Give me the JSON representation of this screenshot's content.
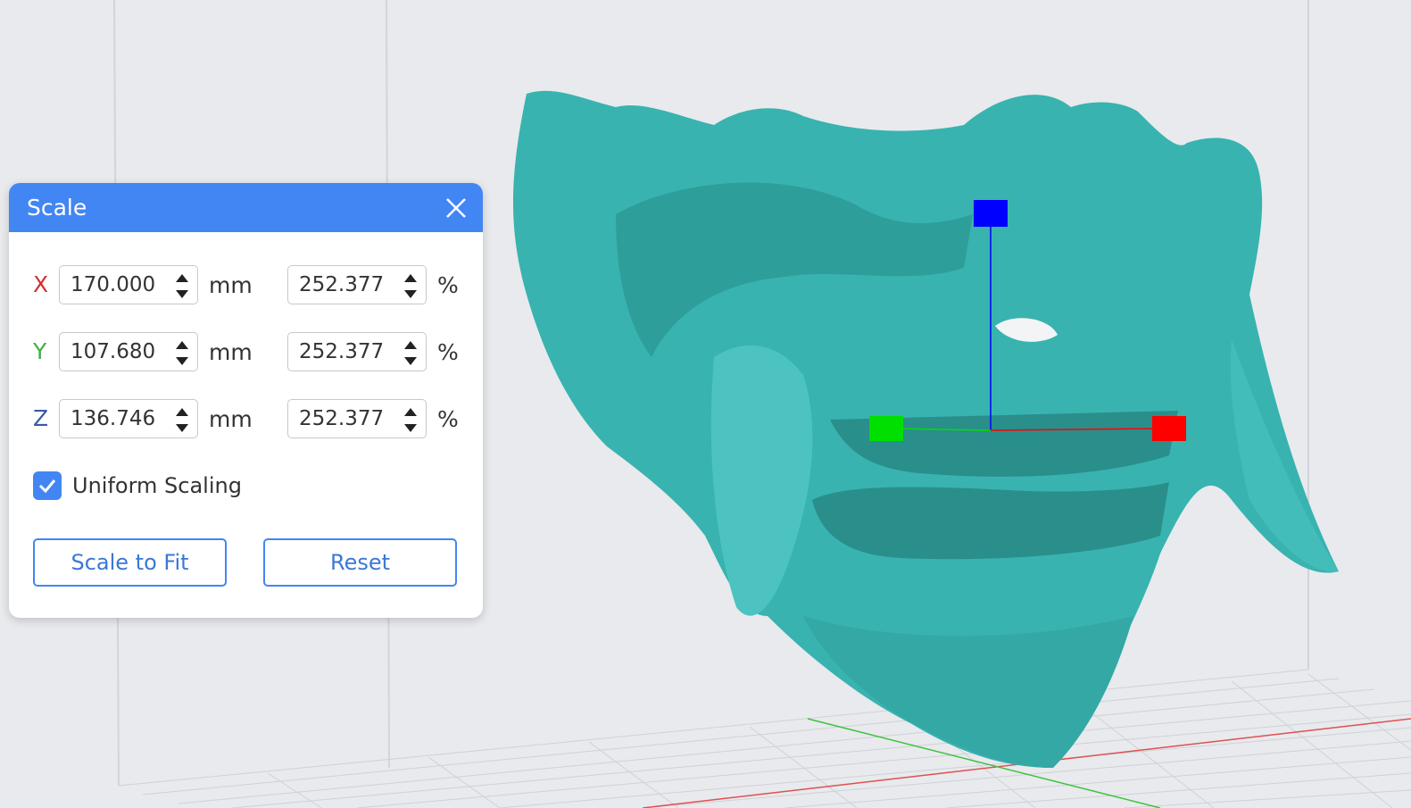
{
  "panel": {
    "title": "Scale",
    "rows": [
      {
        "axis": "X",
        "axis_color": "#d03030",
        "mm": "170.000",
        "mm_unit": "mm",
        "percent": "252.377",
        "percent_unit": "%"
      },
      {
        "axis": "Y",
        "axis_color": "#3cb043",
        "mm": "107.680",
        "mm_unit": "mm",
        "percent": "252.377",
        "percent_unit": "%"
      },
      {
        "axis": "Z",
        "axis_color": "#3a5aa8",
        "mm": "136.746",
        "mm_unit": "mm",
        "percent": "252.377",
        "percent_unit": "%"
      }
    ],
    "uniform_scaling": {
      "label": "Uniform Scaling",
      "checked": true
    },
    "scale_to_fit_label": "Scale to Fit",
    "reset_label": "Reset"
  },
  "colors": {
    "accent": "#4286f4",
    "model": "#38b3b0",
    "gizmo_x": "#ff0000",
    "gizmo_y": "#00e000",
    "gizmo_z": "#0000ff"
  }
}
